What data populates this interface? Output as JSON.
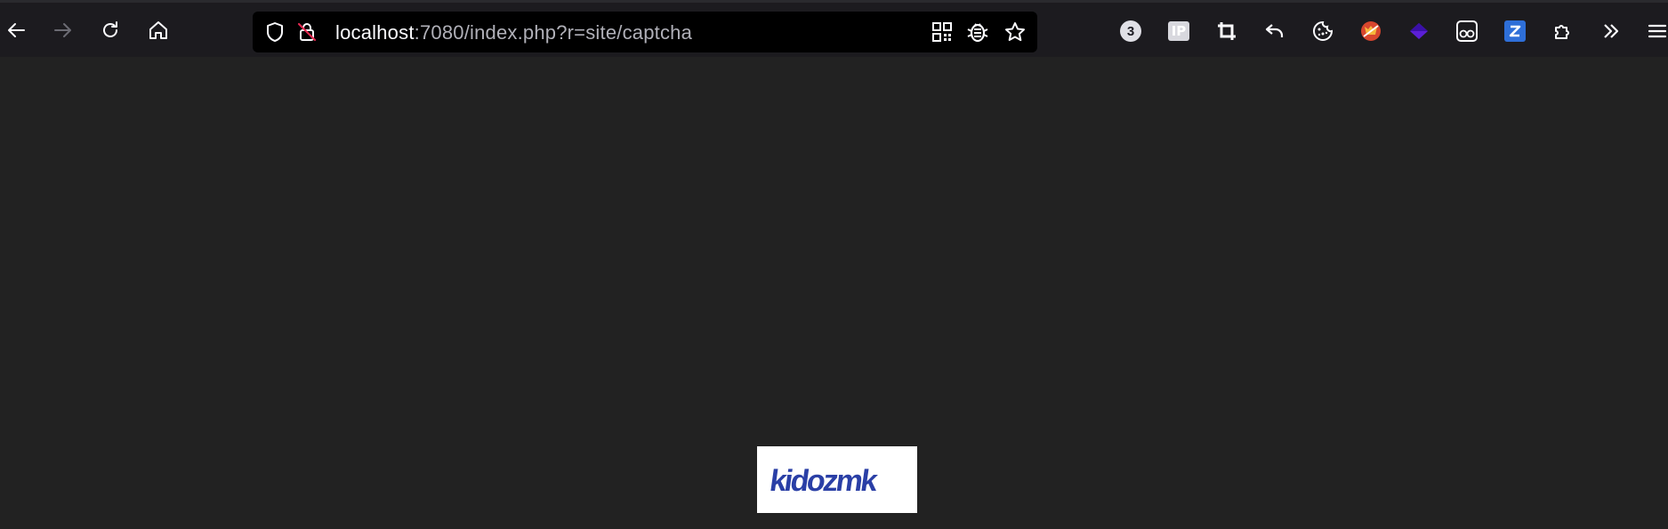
{
  "browser": {
    "toolbar": {
      "back_icon": "arrow-left-icon",
      "forward_icon": "arrow-right-icon",
      "reload_icon": "reload-icon",
      "home_icon": "home-icon"
    },
    "urlbar": {
      "url_host": "localhost",
      "url_rest": ":7080/index.php?r=site/captcha",
      "icons": [
        "shield-icon",
        "insecure-lock-icon",
        "qr-code-icon",
        "bug-icon",
        "star-icon"
      ]
    },
    "extensions": {
      "badge_count": "3",
      "ip_label": "IP",
      "icons": [
        "badge-3-icon",
        "ip-icon",
        "crop-icon",
        "undo-icon",
        "cookie-icon",
        "fox-icon",
        "diamond-icon",
        "glasses-icon",
        "zotero-icon",
        "puzzle-icon",
        "overflow-chevron-icon",
        "hamburger-menu-icon"
      ]
    }
  },
  "page": {
    "background_color": "#222222",
    "captcha": {
      "text": "kidozmk",
      "color": "#2a3fa6"
    }
  }
}
